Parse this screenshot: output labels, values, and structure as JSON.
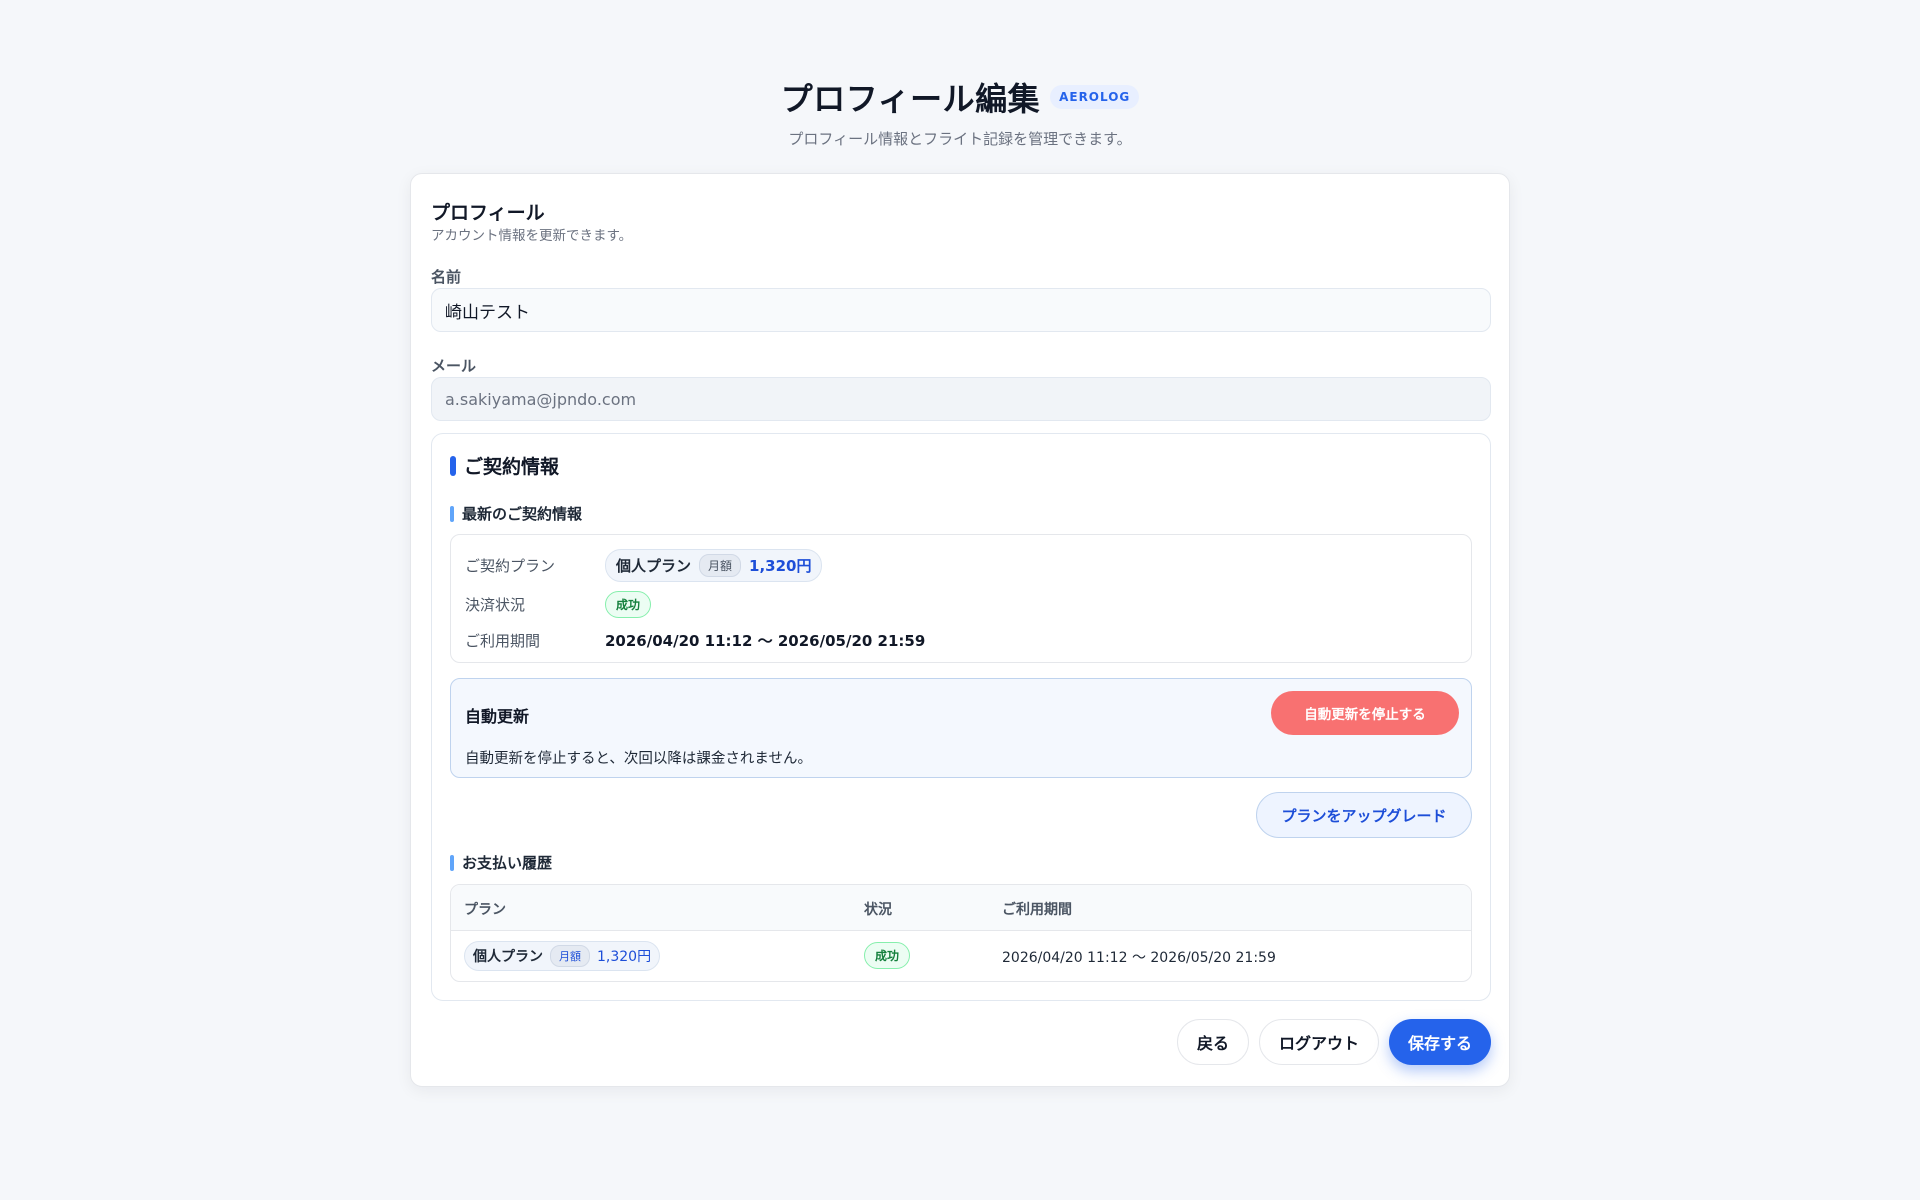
{
  "header": {
    "title": "プロフィール編集",
    "brand_badge": "AEROLOG",
    "subtitle": "プロフィール情報とフライト記録を管理できます。"
  },
  "profile": {
    "title": "プロフィール",
    "description": "アカウント情報を更新できます。",
    "name_label": "名前",
    "name_value": "崎山テスト",
    "email_label": "メール",
    "email_value": "a.sakiyama@jpndo.com"
  },
  "contract": {
    "title": "ご契約情報",
    "latest_title": "最新のご契約情報",
    "plan_label": "ご契約プラン",
    "plan_name": "個人プラン",
    "plan_period": "月額",
    "plan_price": "1,320円",
    "payment_label": "決済状況",
    "payment_status": "成功",
    "usage_label": "ご利用期間",
    "usage_period": "2026/04/20 11:12 〜 2026/05/20 21:59",
    "auto_renew": {
      "title": "自動更新",
      "stop_button": "自動更新を停止する",
      "description": "自動更新を停止すると、次回以降は課金されません。"
    },
    "upgrade_button": "プランをアップグレード"
  },
  "history": {
    "title": "お支払い履歴",
    "columns": [
      "プラン",
      "状況",
      "ご利用期間"
    ],
    "rows": [
      {
        "plan_name": "個人プラン",
        "plan_period": "月額",
        "plan_price": "1,320円",
        "status": "成功",
        "period": "2026/04/20 11:12 〜 2026/05/20 21:59"
      }
    ]
  },
  "footer": {
    "back_button": "戻る",
    "logout_button": "ログアウト",
    "save_button": "保存する"
  },
  "colors": {
    "accent": "#2563eb",
    "danger": "#f87171",
    "success": "#15803d",
    "background": "#f5f7fa"
  }
}
